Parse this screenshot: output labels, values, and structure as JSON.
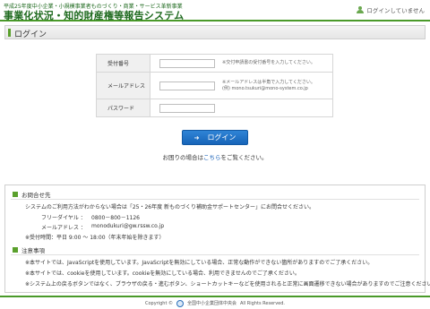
{
  "header": {
    "subtitle": "平成25年度中小企業・小規模事業者ものづくり・商業・サービス革新事業",
    "title": "事業化状況・知的財産権等報告システム",
    "login_status": "ログインしていません"
  },
  "page_title": "ログイン",
  "form": {
    "fields": [
      {
        "label": "受付番号",
        "note_1": "※交付申請書の受付番号を入力してください。",
        "note_2": ""
      },
      {
        "label": "メールアドレス",
        "note_1": "※メールアドレスは半角で入力してください。",
        "note_2": "(例) mono.tsukuri@mono-system.co.jp"
      },
      {
        "label": "パスワード",
        "note_1": "",
        "note_2": ""
      }
    ]
  },
  "login_button": "ログイン",
  "help": {
    "prefix": "お困りの場合は",
    "link": "こちら",
    "suffix": "をご覧ください。"
  },
  "contact": {
    "heading": "お問合せ先",
    "intro": "システムのご利用方法がわからない場合は「25・26年度 新ものづくり補助金サポートセンター」にお問合せください。",
    "freedial_label": "フリーダイヤル ：",
    "freedial_value": "0800－800－1126",
    "email_label": "メールアドレス ：",
    "email_value": "monodukuri@gw.rssw.co.jp",
    "hours": "※受付時間：平日 9:00 ～ 18:00（年末年始を除きます）"
  },
  "notes": {
    "heading": "注意事項",
    "lines": [
      "※本サイトでは、JavaScriptを使用しています。JavaScriptを無効にしている場合、正常な動作ができない箇所がありますのでご了承ください。",
      "※本サイトでは、cookieを使用しています。cookieを無効にしている場合、利用できませんのでご了承ください。",
      "※システム上の戻るボタンではなく、ブラウザの戻る・進むボタン、ショートカットキーなどを使用されると正常に画面遷移できない場合がありますのでご注意ください。"
    ]
  },
  "footer": {
    "copyright": "Copyright ©",
    "org": "全国中小企業団体中央会",
    "rights": "All Rights Reserved."
  }
}
